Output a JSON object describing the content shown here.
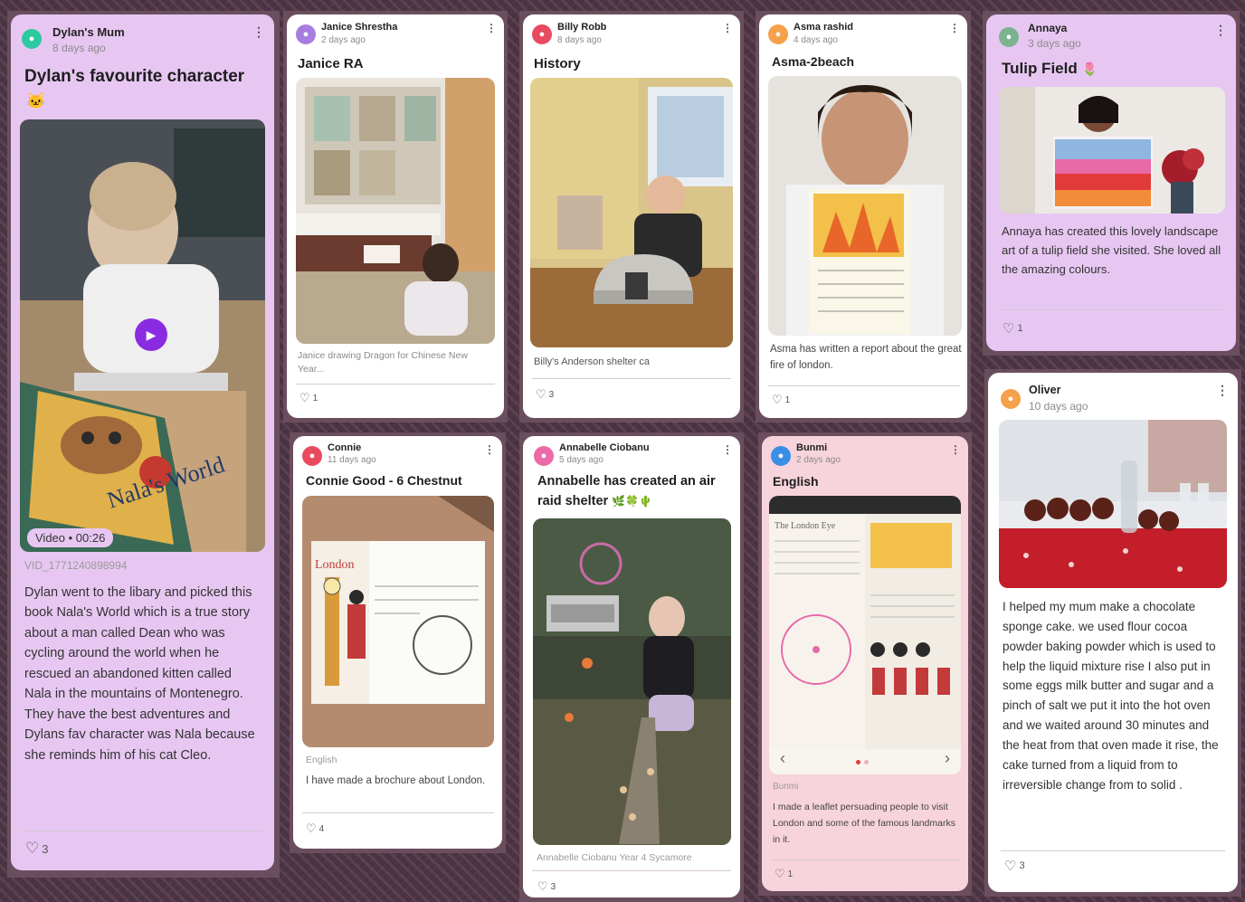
{
  "cards": {
    "c1": {
      "author": "Dylan's Mum",
      "time": "8 days ago",
      "title": "Dylan's favourite character",
      "emoji": "🐱",
      "badge": "Video • 00:26",
      "file": "VID_1771240898994",
      "caption": "Dylan went to the libary and picked this book Nala's World which is a true story about a man called Dean who was cycling around the world when he rescued an abandoned kitten called Nala in the mountains of Montenegro. They have the best adventures and Dylans fav character was Nala because she reminds him of his cat Cleo.",
      "likes": "3",
      "book_title": "Nala's World"
    },
    "c2": {
      "author": "Janice Shrestha",
      "time": "2 days ago",
      "title": "Janice RA",
      "caption": "Janice drawing Dragon for Chinese New Year...",
      "likes": "1"
    },
    "c3": {
      "author": "Billy Robb",
      "time": "8 days ago",
      "title": "History",
      "caption": "Billy's Anderson shelter ca",
      "likes": "3"
    },
    "c4": {
      "author": "Asma rashid",
      "time": "4 days ago",
      "title": "Asma-2beach",
      "caption": "Asma has written a report about the great fire of london.",
      "likes": "1"
    },
    "c5": {
      "author": "Annaya",
      "time": "3 days ago",
      "title": "Tulip Field",
      "emoji": "🌷",
      "caption": "Annaya has created this lovely landscape art of a tulip field she visited. She loved all the amazing colours.",
      "likes": "1"
    },
    "c6": {
      "author": "Connie",
      "time": "11 days ago",
      "title": "Connie Good - 6 Chestnut",
      "subject": "English",
      "caption": "I have made a brochure about London.",
      "likes": "4",
      "brochure_word": "London"
    },
    "c7": {
      "author": "Annabelle Ciobanu",
      "time": "5 days ago",
      "title_line1": "Annabelle has created an air",
      "title_line2": "raid shelter",
      "emoji": "🌿🍀🌵",
      "caption": "Annabelle Ciobanu Year 4 Sycamore",
      "likes": "3"
    },
    "c8": {
      "author": "Bunmi",
      "time": "2 days ago",
      "title": "English",
      "subject": "Bunmi",
      "caption": "I made a leaflet persuading people to visit London and some of the famous landmarks in it.",
      "likes": "1",
      "nav_prev": "‹",
      "nav_next": "›",
      "leaflet_word": "The London Eye"
    },
    "c9": {
      "author": "Oliver",
      "time": "10 days ago",
      "caption": "I helped my mum make a chocolate sponge cake. we used flour cocoa powder baking powder which is used to help the liquid mixture rise I also put in some eggs milk butter and sugar and  a pinch of salt we put it into the hot oven and we waited around 30 minutes and the heat from that oven made it rise, the cake turned from a liquid from to irreversible change from to solid .",
      "likes": "3"
    }
  },
  "icons": {
    "kebab": "⋮",
    "heart": "♡",
    "play": "▶"
  },
  "colors": {
    "purple_card": "#e7c7f2",
    "pink_card": "#f7d3dc",
    "play_button": "#8a2be2",
    "background": "#4a3340"
  }
}
